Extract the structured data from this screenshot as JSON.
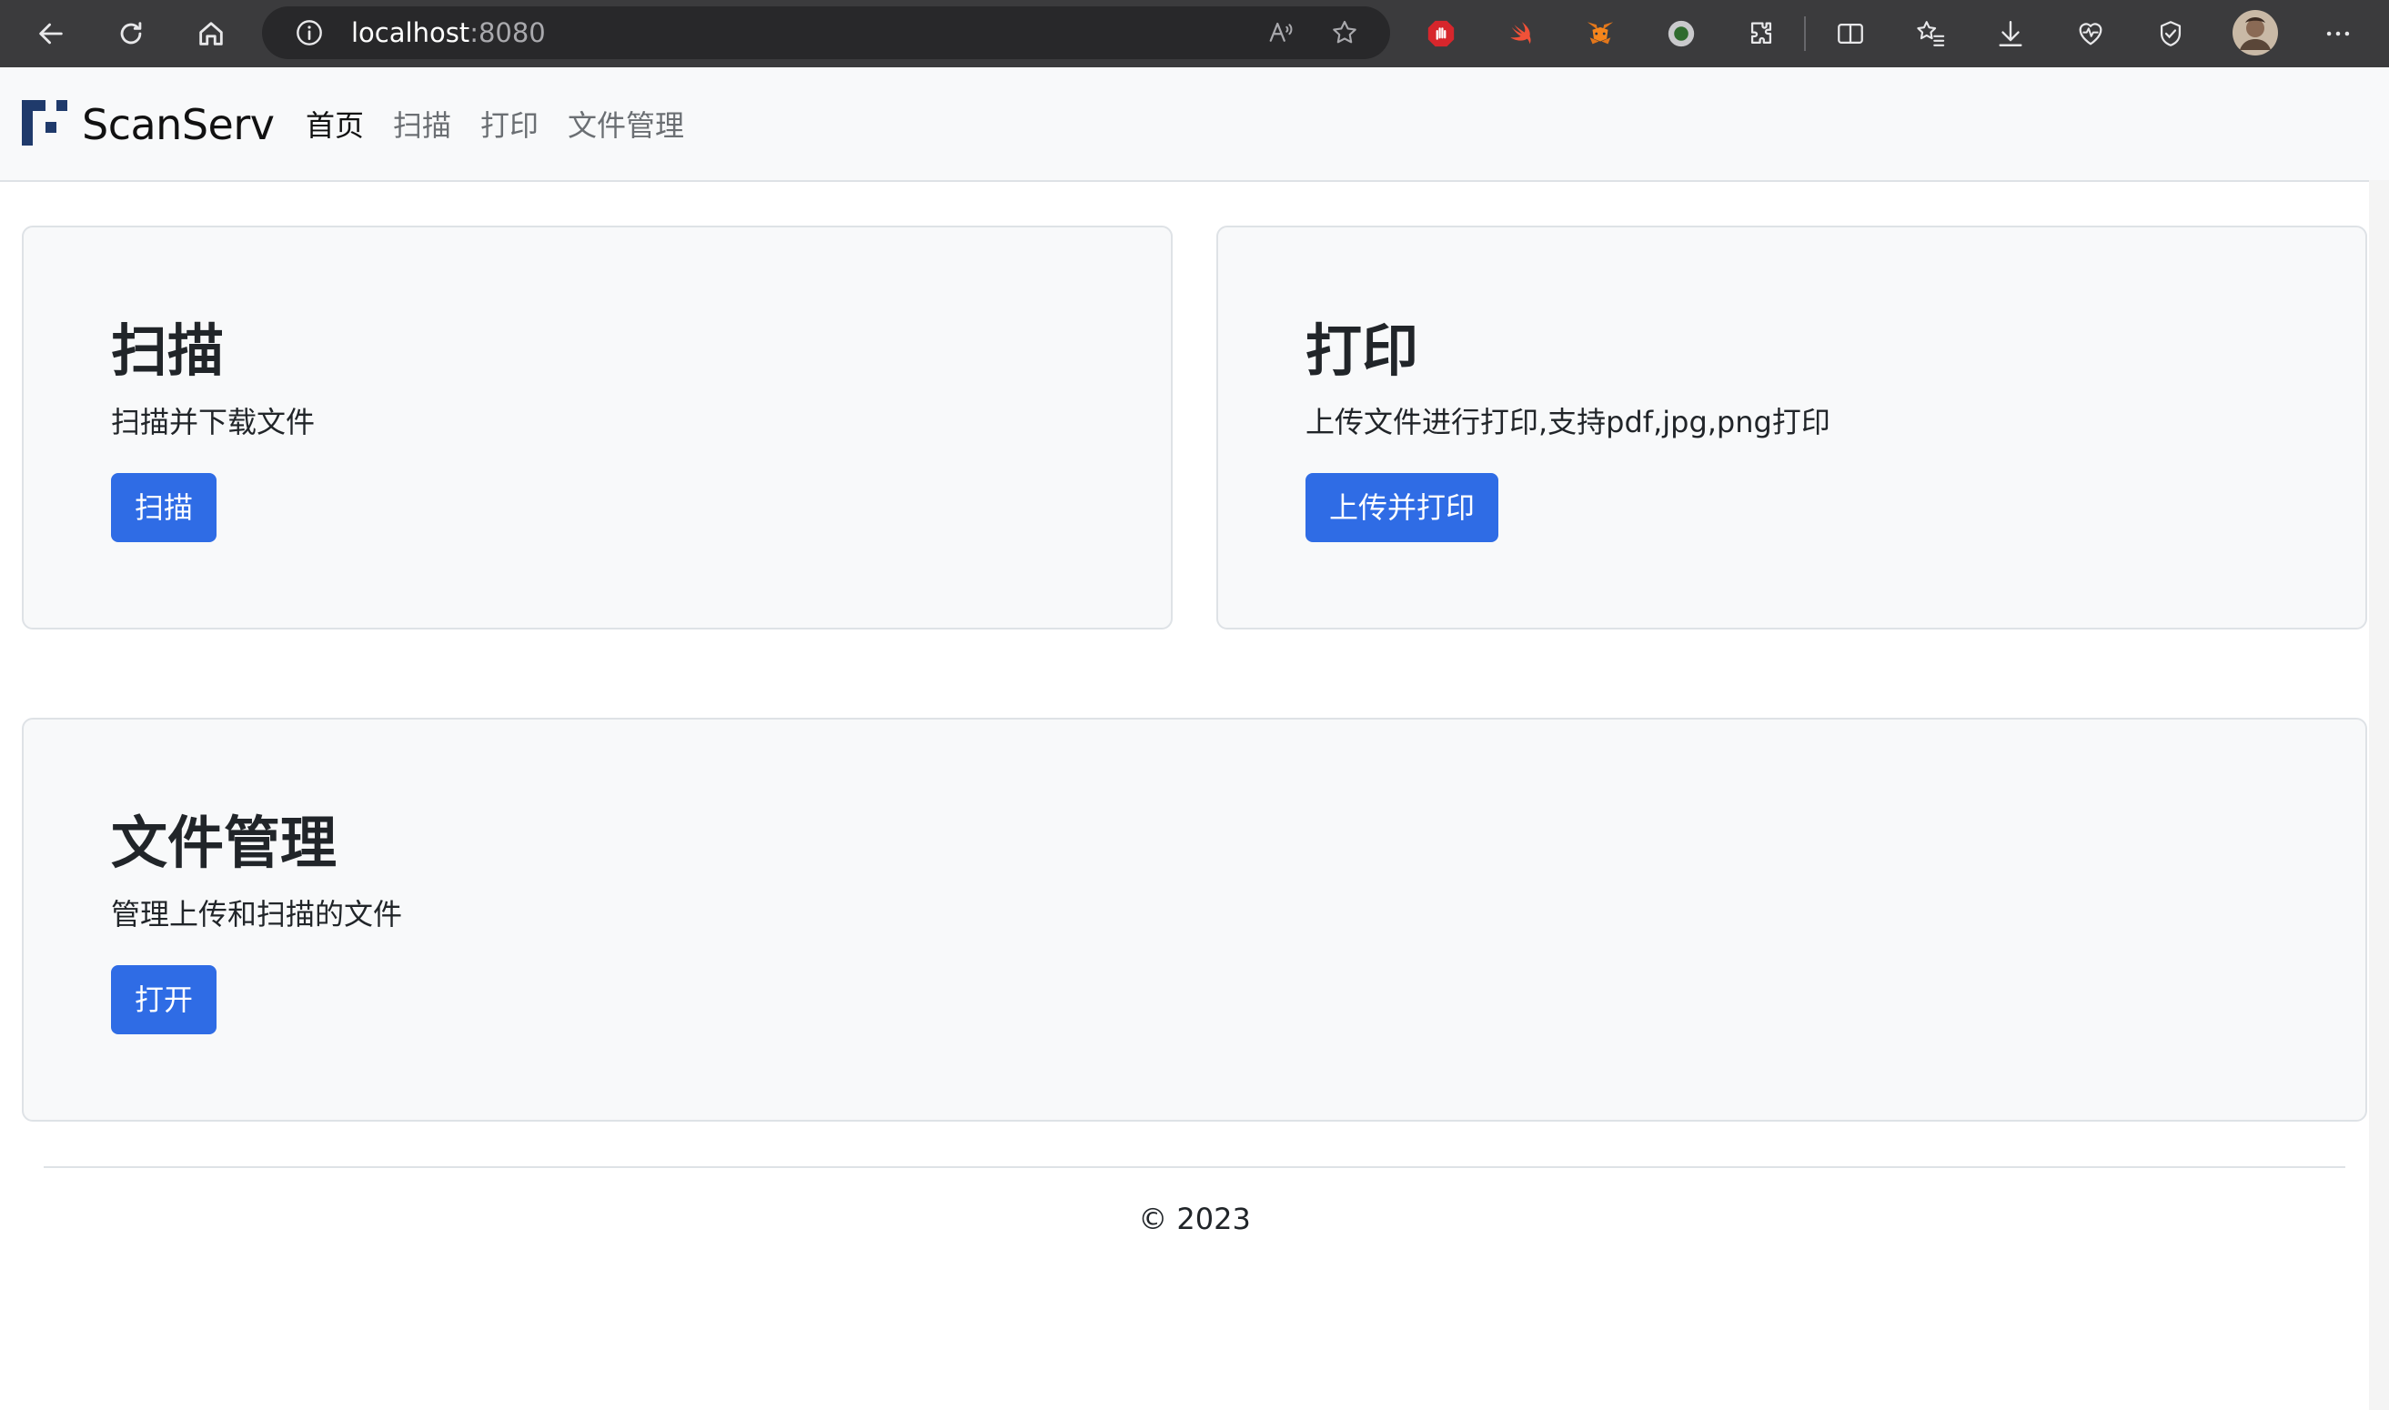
{
  "browser": {
    "url_host": "localhost",
    "url_port": ":8080",
    "icons": {
      "back": "back-arrow-icon",
      "reload": "reload-icon",
      "home": "home-icon",
      "info": "site-info-icon",
      "read_aloud": "read-aloud-icon",
      "favorite": "favorite-star-icon",
      "extensions": [
        "adblock-icon",
        "swift-icon",
        "metamask-fox-icon",
        "record-icon",
        "extensions-puzzle-icon"
      ],
      "split": "split-screen-icon",
      "favorites": "favorites-list-icon",
      "downloads": "download-icon",
      "health": "browser-essentials-icon",
      "copilot": "performance-icon",
      "profile": "profile-avatar",
      "more": "more-menu-icon"
    }
  },
  "navbar": {
    "brand": "ScanServ",
    "links": [
      {
        "label": "首页",
        "active": true
      },
      {
        "label": "扫描",
        "active": false
      },
      {
        "label": "打印",
        "active": false
      },
      {
        "label": "文件管理",
        "active": false
      }
    ]
  },
  "cards": {
    "scan": {
      "title": "扫描",
      "description": "扫描并下载文件",
      "button": "扫描"
    },
    "print": {
      "title": "打印",
      "description": "上传文件进行打印,支持pdf,jpg,png打印",
      "button": "上传并打印"
    },
    "files": {
      "title": "文件管理",
      "description": "管理上传和扫描的文件",
      "button": "打开"
    }
  },
  "footer": {
    "text": "© 2023"
  },
  "colors": {
    "primary_button": "#2f6ce5",
    "card_bg": "#f8f9fa",
    "brand_logo": "#1f3a6b",
    "browser_chrome": "#3b3b3d"
  }
}
